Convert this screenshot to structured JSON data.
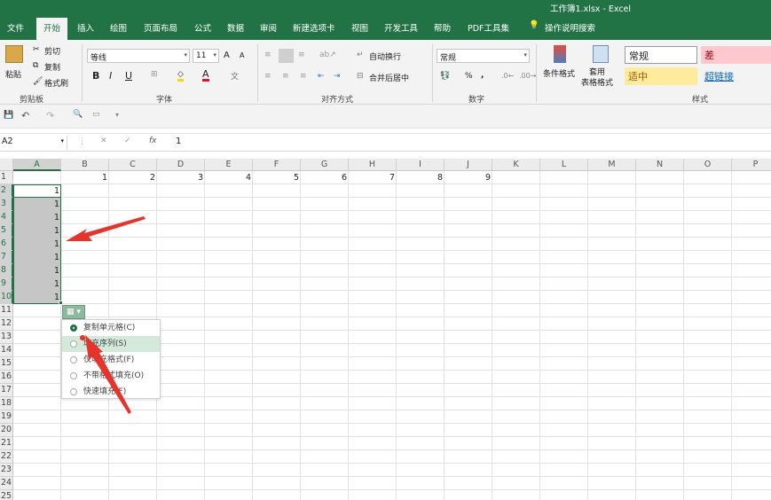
{
  "title": "工作簿1.xlsx  -  Excel",
  "menu": [
    "文件",
    "开始",
    "插入",
    "绘图",
    "页面布局",
    "公式",
    "数据",
    "审阅",
    "新建选项卡",
    "视图",
    "开发工具",
    "帮助",
    "PDF工具集",
    "操作说明搜索"
  ],
  "ribbon": {
    "clipboard": {
      "paste": "粘贴",
      "cut": "剪切",
      "copy": "复制",
      "format_painter": "格式刷",
      "group": "剪贴板"
    },
    "font": {
      "name": "等线",
      "size": "11",
      "bold": "B",
      "italic": "I",
      "underline": "U",
      "group": "字体",
      "grow": "A",
      "shrink": "A",
      "font_color": "A"
    },
    "alignment": {
      "wrap": "自动换行",
      "merge": "合并后居中",
      "group": "对齐方式"
    },
    "number": {
      "format": "常规",
      "percent": "%",
      "comma": ",",
      "group": "数字"
    },
    "styles": {
      "conditional": "条件格式",
      "table": "套用\n表格格式",
      "normal": "常规",
      "bad": "差",
      "neutral": "适中",
      "hyperlink": "超链接",
      "group": "样式"
    }
  },
  "namebox": "A2",
  "formula": {
    "cancel": "✕",
    "enter": "✓",
    "fx": "fx",
    "value": "1"
  },
  "columns": [
    "A",
    "B",
    "C",
    "D",
    "E",
    "F",
    "G",
    "H",
    "I",
    "J",
    "K",
    "L",
    "M",
    "N",
    "O",
    "P"
  ],
  "rows": [
    "1",
    "2",
    "3",
    "4",
    "5",
    "6",
    "7",
    "8",
    "9",
    "10",
    "11",
    "12",
    "13",
    "14",
    "15",
    "16",
    "17",
    "18",
    "19",
    "20",
    "21",
    "22",
    "23",
    "24",
    "25"
  ],
  "row1_values": [
    "1",
    "2",
    "3",
    "4",
    "5",
    "6",
    "7",
    "8",
    "9"
  ],
  "colA_values": [
    "1",
    "1",
    "1",
    "1",
    "1",
    "1",
    "1",
    "1",
    "1"
  ],
  "autofill_options": [
    {
      "label": "复制单元格(C)",
      "selected": true
    },
    {
      "label": "填充序列(S)",
      "selected": false
    },
    {
      "label": "仅填充格式(F)",
      "selected": false
    },
    {
      "label": "不带格式填充(O)",
      "selected": false
    },
    {
      "label": "快速填充(F)",
      "selected": false
    }
  ],
  "colors": {
    "excel_green": "#217346",
    "selection": "#c6c6c6",
    "highlight": "#d3eadb",
    "arrow": "#e8332a"
  }
}
